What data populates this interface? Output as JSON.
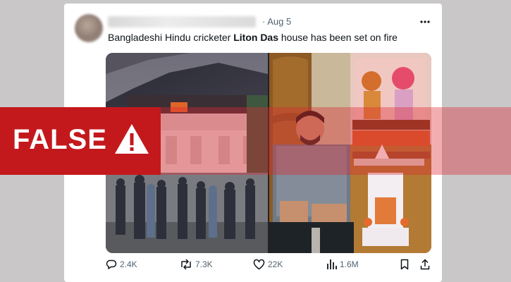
{
  "tweet": {
    "date": "· Aug 5",
    "more_icon": "more-horizontal-icon",
    "text_before": "Bangladeshi Hindu cricketer ",
    "text_bold": "Liton Das",
    "text_after": " house has been set on fire"
  },
  "media": {
    "left_photo": "burning-house-photo",
    "right_photo": "man-seated-by-shrine-photo"
  },
  "actions": {
    "replies": {
      "icon": "reply-icon",
      "count": "2.4K"
    },
    "reposts": {
      "icon": "repost-icon",
      "count": "7.3K"
    },
    "likes": {
      "icon": "like-icon",
      "count": "22K"
    },
    "views": {
      "icon": "views-icon",
      "count": "1.6M"
    },
    "bookmark_icon": "bookmark-icon",
    "share_icon": "share-icon"
  },
  "verdict": {
    "label": "FALSE",
    "icon": "warning-icon",
    "color": "#c3191d"
  }
}
